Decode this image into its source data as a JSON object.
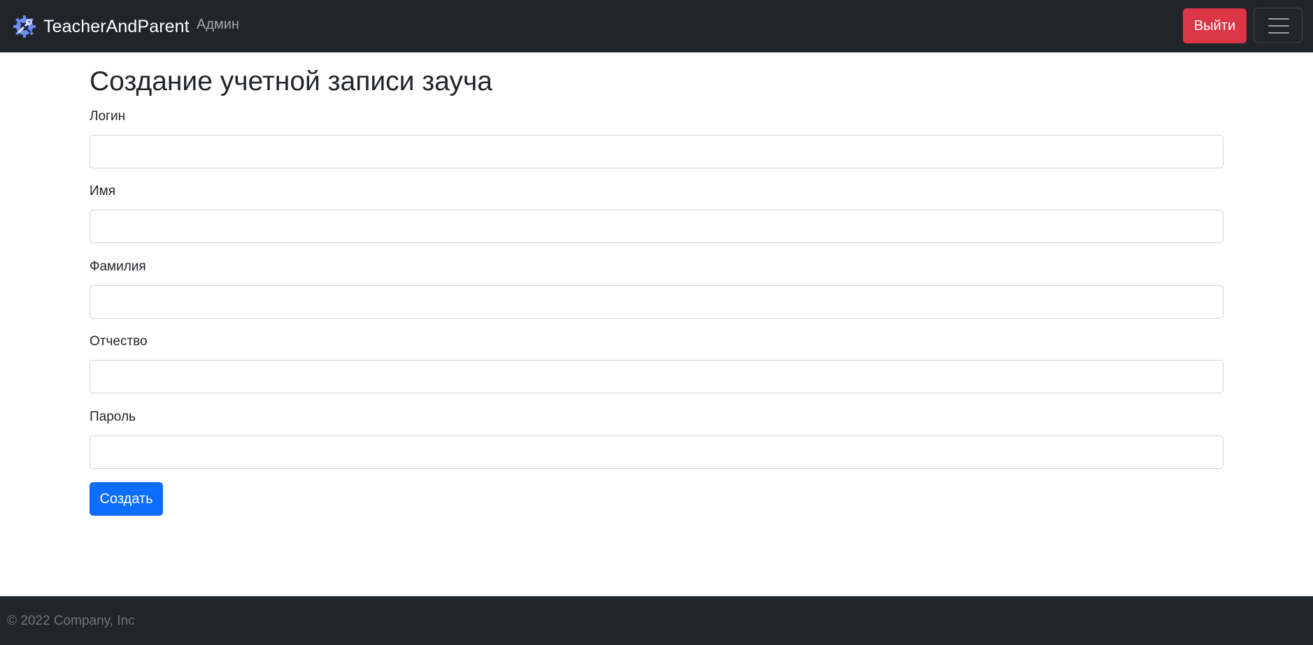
{
  "navbar": {
    "brand": "TeacherAndParent",
    "brand_icon": "gear-wrench-icon",
    "brand_icon_color": "#6f8cf0",
    "link_admin": "Админ",
    "logout_label": "Выйти",
    "menu_icon": "hamburger-menu-icon",
    "colors": {
      "background": "#212529",
      "logout": "#dc3545"
    }
  },
  "form": {
    "title": "Создание учетной записи зауча",
    "fields": [
      {
        "label": "Логин",
        "value": "",
        "placeholder": ""
      },
      {
        "label": "Имя",
        "value": "",
        "placeholder": ""
      },
      {
        "label": "Фамилия",
        "value": "",
        "placeholder": ""
      },
      {
        "label": "Отчество",
        "value": "",
        "placeholder": ""
      },
      {
        "label": "Пароль",
        "value": "",
        "placeholder": ""
      }
    ],
    "submit_label": "Создать",
    "submit_color": "#0d6efd"
  },
  "footer": {
    "text": "© 2022 Company, Inc"
  }
}
